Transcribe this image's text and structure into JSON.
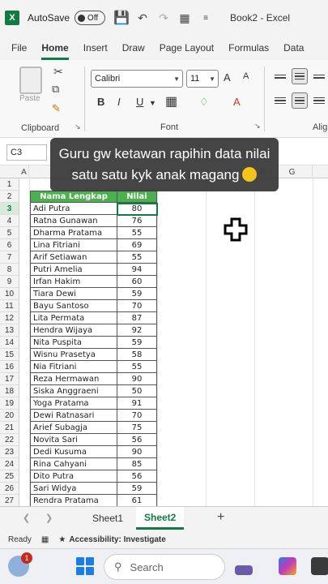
{
  "titlebar": {
    "autosave_label": "AutoSave",
    "toggle_state": "Off",
    "doc_title": "Book2 - Excel"
  },
  "tabs": [
    "File",
    "Home",
    "Insert",
    "Draw",
    "Page Layout",
    "Formulas",
    "Data"
  ],
  "ribbon": {
    "paste_label": "Paste",
    "clipboard_label": "Clipboard",
    "font_name": "Calibri",
    "font_size": "11",
    "font_label": "Font",
    "alignment_label": "Alig",
    "bold": "B",
    "italic": "I",
    "underline": "U",
    "grow_font": "A",
    "shrink_font": "A",
    "font_color": "A"
  },
  "formula_bar": {
    "name_box": "C3"
  },
  "columns": [
    "A",
    "B",
    "C",
    "D",
    "E",
    "F",
    "G"
  ],
  "caption": {
    "line1": "Guru gw ketawan rapihin data nilai",
    "line2": "satu satu kyk anak magang"
  },
  "table": {
    "headers": [
      "Nama Lengkap",
      "Nilai"
    ],
    "rows": [
      {
        "name": "Adi Putra",
        "score": "80"
      },
      {
        "name": "Ratna Gunawan",
        "score": "76"
      },
      {
        "name": "Dharma Pratama",
        "score": "55"
      },
      {
        "name": "Lina Fitriani",
        "score": "69"
      },
      {
        "name": "Arif Setiawan",
        "score": "55"
      },
      {
        "name": "Putri Amelia",
        "score": "94"
      },
      {
        "name": "Irfan Hakim",
        "score": "60"
      },
      {
        "name": "Tiara Dewi",
        "score": "59"
      },
      {
        "name": "Bayu Santoso",
        "score": "70"
      },
      {
        "name": "Lita Permata",
        "score": "87"
      },
      {
        "name": "Hendra Wijaya",
        "score": "92"
      },
      {
        "name": "Nita Puspita",
        "score": "59"
      },
      {
        "name": "Wisnu Prasetya",
        "score": "58"
      },
      {
        "name": "Nia Fitriani",
        "score": "55"
      },
      {
        "name": "Reza Hermawan",
        "score": "90"
      },
      {
        "name": "Siska Anggraeni",
        "score": "50"
      },
      {
        "name": "Yoga Pratama",
        "score": "91"
      },
      {
        "name": "Dewi Ratnasari",
        "score": "70"
      },
      {
        "name": "Arief Subagja",
        "score": "75"
      },
      {
        "name": "Novita Sari",
        "score": "56"
      },
      {
        "name": "Dedi Kusuma",
        "score": "90"
      },
      {
        "name": "Rina Cahyani",
        "score": "85"
      },
      {
        "name": "Dito Putra",
        "score": "56"
      },
      {
        "name": "Sari Widya",
        "score": "59"
      },
      {
        "name": "Rendra Pratama",
        "score": "61"
      }
    ]
  },
  "row_numbers": [
    "1",
    "2",
    "3",
    "4",
    "5",
    "6",
    "7",
    "8",
    "9",
    "10",
    "11",
    "12",
    "13",
    "14",
    "15",
    "16",
    "17",
    "18",
    "19",
    "20",
    "21",
    "22",
    "23",
    "24",
    "25",
    "26",
    "27"
  ],
  "sheets": [
    "Sheet1",
    "Sheet2"
  ],
  "active_sheet": "Sheet2",
  "status": {
    "ready": "Ready",
    "accessibility": "Accessibility: Investigate"
  },
  "taskbar": {
    "weather_badge": "1",
    "search_placeholder": "Search"
  },
  "colors": {
    "excel_green": "#107c41",
    "header_green": "#4caf50"
  }
}
